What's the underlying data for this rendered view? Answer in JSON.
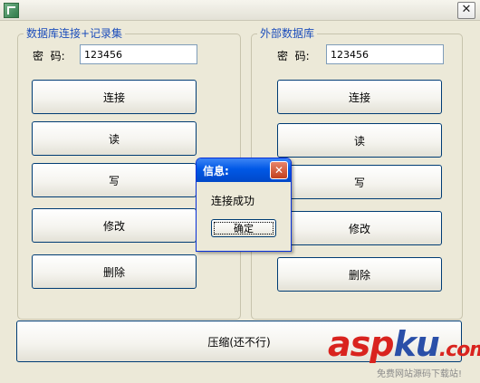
{
  "window": {
    "close_glyph": "✕",
    "icon": "app-icon"
  },
  "left_group": {
    "title": "数据库连接+记录集",
    "password_label": "密  码:",
    "password_value": "123456",
    "buttons": [
      "连接",
      "读",
      "写",
      "修改",
      "删除"
    ]
  },
  "right_group": {
    "title": "外部数据库",
    "password_label": "密  码:",
    "password_value": "123456",
    "buttons": [
      "连接",
      "读",
      "写",
      "修改",
      "删除"
    ]
  },
  "compress_button": "压缩(还不行)",
  "dialog": {
    "title": "信息:",
    "message": "连接成功",
    "ok_label": "确定",
    "close_glyph": "✕"
  },
  "watermark": {
    "logo_a": "asp",
    "logo_b": "ku",
    "logo_c": ".com",
    "subtitle": "免费网站源码下载站!"
  }
}
